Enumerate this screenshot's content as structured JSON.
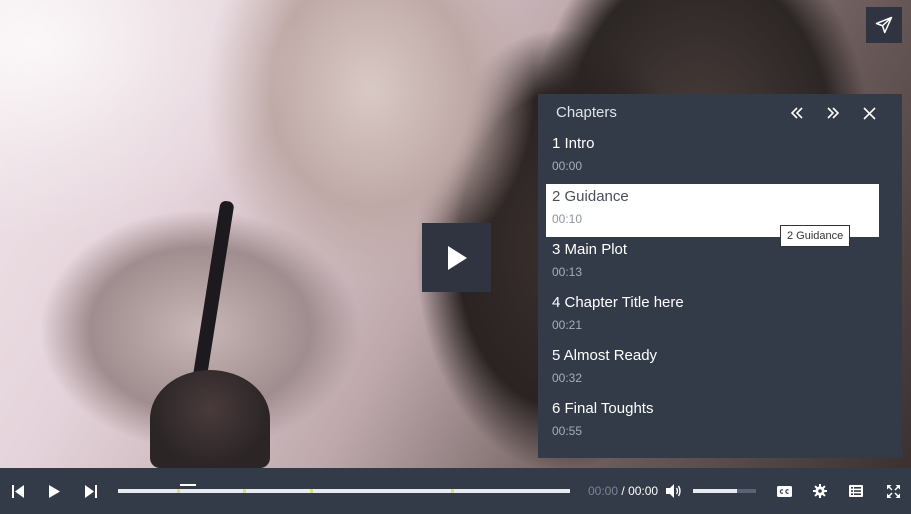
{
  "chapters_panel": {
    "title": "Chapters",
    "items": [
      {
        "label": "1 Intro",
        "time": "00:00"
      },
      {
        "label": "2 Guidance",
        "time": "00:10"
      },
      {
        "label": "3 Main Plot",
        "time": "00:13"
      },
      {
        "label": "4 Chapter Title here",
        "time": "00:21"
      },
      {
        "label": "5 Almost Ready",
        "time": "00:32"
      },
      {
        "label": "6 Final Toughts",
        "time": "00:55"
      }
    ],
    "active_index": 1,
    "tooltip": "2 Guidance"
  },
  "controls": {
    "current_time": "00:00",
    "separator": "/",
    "duration": "00:00",
    "progress_played": 0.0,
    "volume_level": 0.7
  },
  "colors": {
    "panel_bg": "#333a48",
    "button_bg": "#2f3440",
    "chapter_marker": "#d9e07a"
  },
  "icons": {
    "share": "paper-plane-icon",
    "big_play": "play-icon",
    "prev_chapter": "double-chevron-left-icon",
    "next_chapter": "double-chevron-right-icon",
    "close": "close-icon",
    "skip_back": "skip-previous-icon",
    "play": "play-icon",
    "skip_forward": "skip-next-icon",
    "volume": "volume-icon",
    "captions": "cc-icon",
    "settings": "gear-icon",
    "chapters": "list-icon",
    "fullscreen": "fullscreen-icon"
  }
}
